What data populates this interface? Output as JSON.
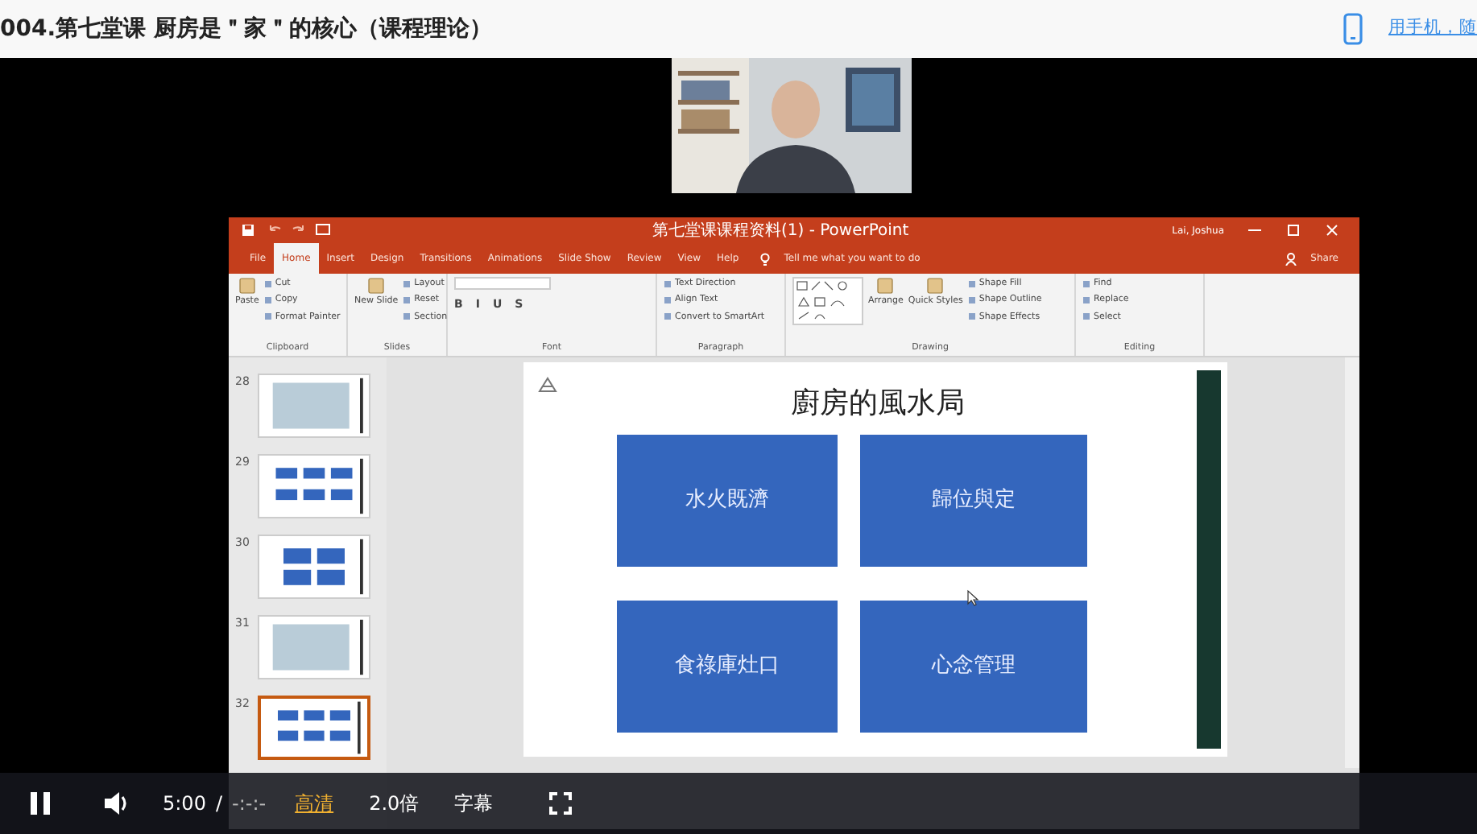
{
  "header": {
    "title": "004.第七堂课 厨房是＂家＂的核心（课程理论）",
    "mobile_link": "用手机，随"
  },
  "video": {
    "powerpoint": {
      "title": "第七堂课课程资料(1) - PowerPoint",
      "user": "Lai, Joshua",
      "tell_me": "Tell me what you want to do",
      "share": "Share",
      "tabs": [
        {
          "label": "File",
          "selected": false
        },
        {
          "label": "Home",
          "selected": true
        },
        {
          "label": "Insert",
          "selected": false
        },
        {
          "label": "Design",
          "selected": false
        },
        {
          "label": "Transitions",
          "selected": false
        },
        {
          "label": "Animations",
          "selected": false
        },
        {
          "label": "Slide Show",
          "selected": false
        },
        {
          "label": "Review",
          "selected": false
        },
        {
          "label": "View",
          "selected": false
        },
        {
          "label": "Help",
          "selected": false
        }
      ],
      "ribbon_groups": [
        {
          "label": "Clipboard",
          "items": [
            {
              "kind": "large",
              "label": "Paste"
            },
            {
              "kind": "small",
              "label": "Cut"
            },
            {
              "kind": "small",
              "label": "Copy"
            },
            {
              "kind": "small",
              "label": "Format Painter"
            }
          ]
        },
        {
          "label": "Slides",
          "items": [
            {
              "kind": "large",
              "label": "New Slide"
            },
            {
              "kind": "small",
              "label": "Layout"
            },
            {
              "kind": "small",
              "label": "Reset"
            },
            {
              "kind": "small",
              "label": "Section"
            }
          ]
        },
        {
          "label": "Font",
          "items": [
            {
              "kind": "field"
            },
            {
              "kind": "glyph",
              "label": "B"
            },
            {
              "kind": "glyph",
              "label": "I"
            },
            {
              "kind": "glyph",
              "label": "U"
            },
            {
              "kind": "glyph",
              "label": "S"
            }
          ]
        },
        {
          "label": "Paragraph",
          "items": [
            {
              "kind": "small",
              "label": "Text Direction"
            },
            {
              "kind": "small",
              "label": "Align Text"
            },
            {
              "kind": "small",
              "label": "Convert to SmartArt"
            }
          ]
        },
        {
          "label": "Drawing",
          "items": [
            {
              "kind": "gallery"
            },
            {
              "kind": "large",
              "label": "Arrange"
            },
            {
              "kind": "large",
              "label": "Quick Styles"
            },
            {
              "kind": "small",
              "label": "Shape Fill"
            },
            {
              "kind": "small",
              "label": "Shape Outline"
            },
            {
              "kind": "small",
              "label": "Shape Effects"
            }
          ]
        },
        {
          "label": "Editing",
          "items": [
            {
              "kind": "small",
              "label": "Find"
            },
            {
              "kind": "small",
              "label": "Replace"
            },
            {
              "kind": "small",
              "label": "Select"
            }
          ]
        }
      ],
      "thumbnails": [
        {
          "number": "28",
          "selected": false
        },
        {
          "number": "29",
          "selected": false
        },
        {
          "number": "30",
          "selected": false
        },
        {
          "number": "31",
          "selected": false
        },
        {
          "number": "32",
          "selected": true
        }
      ],
      "slide": {
        "title": "廚房的風水局",
        "boxes": [
          "水火既濟",
          "歸位與定",
          "食祿庫灶口",
          "心念管理"
        ]
      }
    }
  },
  "controls": {
    "playing": true,
    "time": "5:00",
    "separator": "/",
    "duration": "-:-:-",
    "quality": "高清",
    "speed": "2.0倍",
    "subtitles": "字幕"
  }
}
